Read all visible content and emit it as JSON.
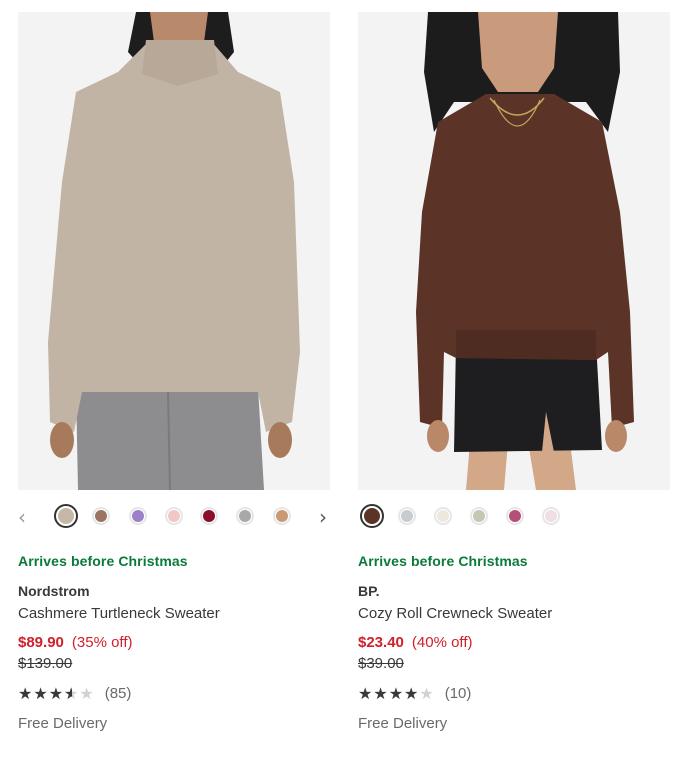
{
  "products": [
    {
      "arrival": "Arrives before Christmas",
      "brand": "Nordstrom",
      "name": "Cashmere Turtleneck Sweater",
      "sale_price": "$89.90",
      "discount": "(35% off)",
      "original_price": "$139.00",
      "rating": 3.5,
      "rating_max": 5,
      "review_count": "(85)",
      "delivery": "Free Delivery",
      "swatch_colors": [
        "#c5b8a6",
        "#9a7461",
        "#9c7fc8",
        "#f0c8c8",
        "#8a0f2a",
        "#a9a9ab",
        "#c99a74"
      ],
      "selected_swatch": 0,
      "image": "model-wearing-taupe-turtleneck-sweater",
      "prev_icon": "chevron-left-icon",
      "next_icon": "chevron-right-icon"
    },
    {
      "arrival": "Arrives before Christmas",
      "brand": "BP.",
      "name": "Cozy Roll Crewneck Sweater",
      "sale_price": "$23.40",
      "discount": "(40% off)",
      "original_price": "$39.00",
      "rating": 4,
      "rating_max": 5,
      "review_count": "(10)",
      "delivery": "Free Delivery",
      "swatch_colors": [
        "#5a3424",
        "#c9ccce",
        "#ece8de",
        "#c2c8b2",
        "#b44f78",
        "#f1dde4"
      ],
      "selected_swatch": 0,
      "image": "model-wearing-brown-crewneck-sweater"
    }
  ]
}
